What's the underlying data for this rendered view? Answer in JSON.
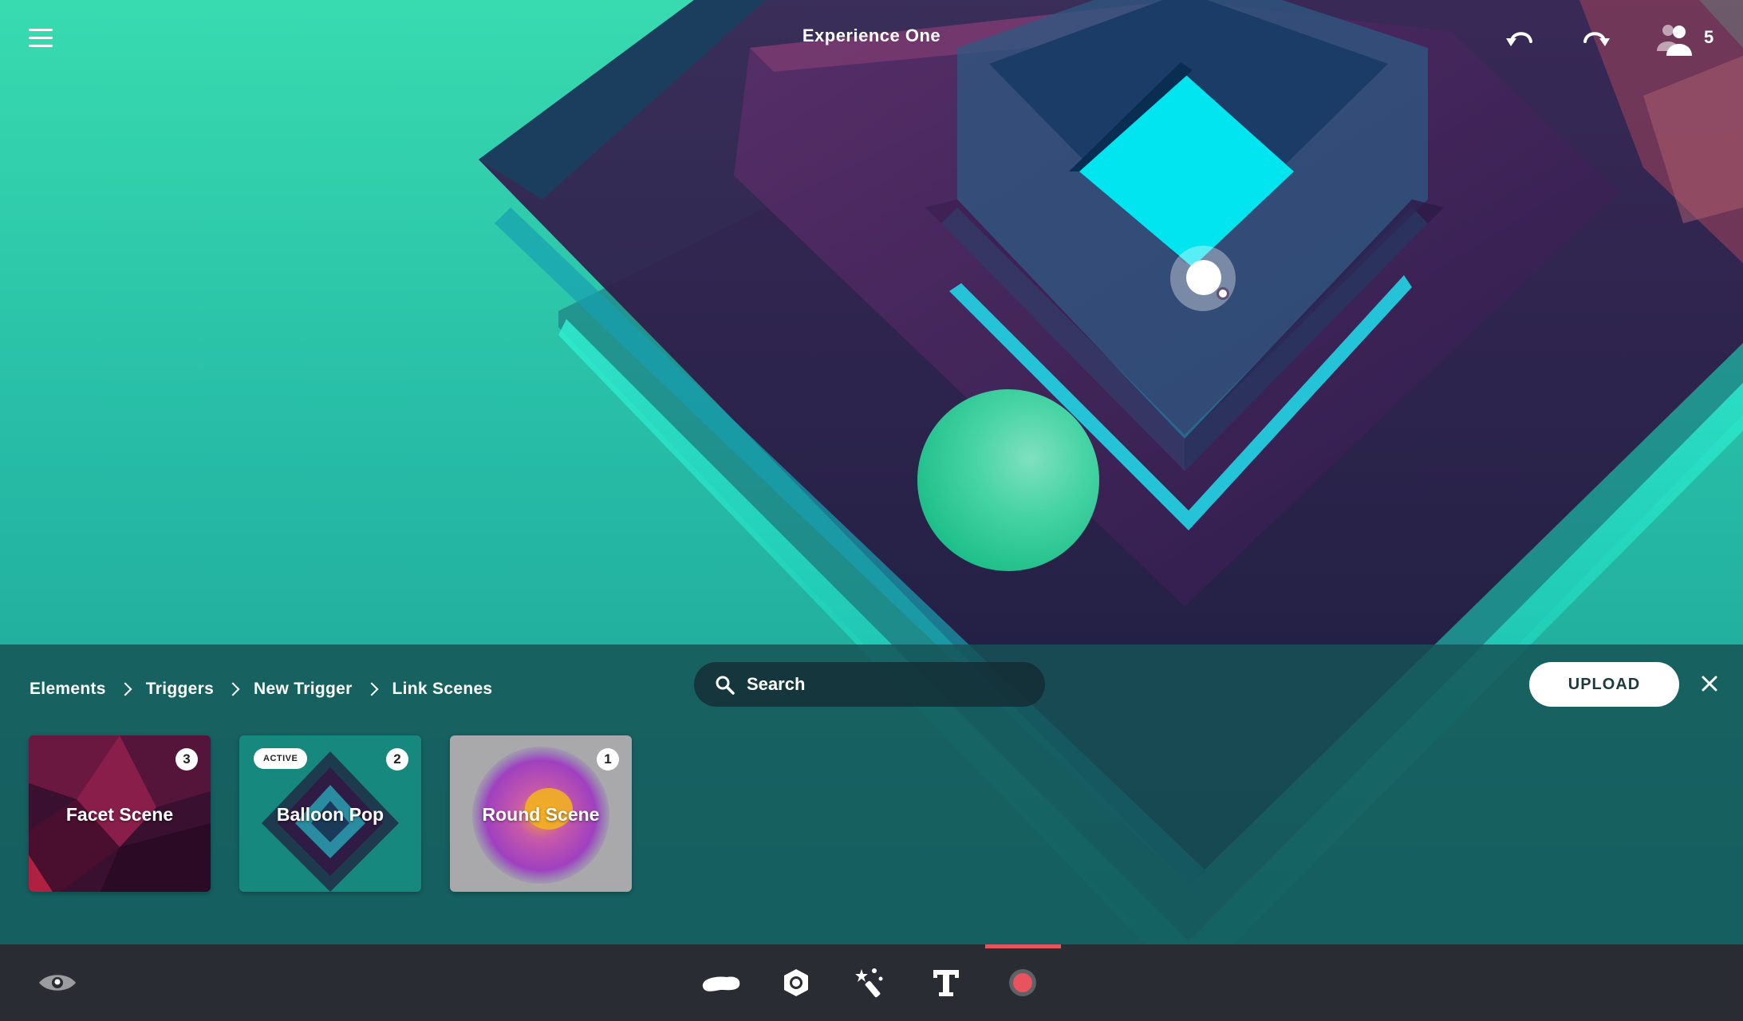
{
  "app": {
    "title": "Experience One",
    "user_count": "5"
  },
  "topbar": {
    "menu_icon": "hamburger-menu-icon",
    "undo_icon": "undo-icon",
    "redo_icon": "redo-icon",
    "users_icon": "users-icon"
  },
  "breadcrumb": [
    {
      "label": "Elements"
    },
    {
      "label": "Triggers"
    },
    {
      "label": "New Trigger"
    },
    {
      "label": "Link Scenes"
    }
  ],
  "search": {
    "placeholder": "Search",
    "value": ""
  },
  "upload_label": "UPLOAD",
  "scenes": [
    {
      "label": "Facet Scene",
      "count": "3",
      "badge": ""
    },
    {
      "label": "Balloon Pop",
      "count": "2",
      "badge": "ACTIVE"
    },
    {
      "label": "Round Scene",
      "count": "1",
      "badge": ""
    }
  ],
  "toolbar": {
    "tools": [
      "eye-icon",
      "object-icon",
      "hotspot-icon",
      "effects-icon",
      "text-icon",
      "record-icon"
    ],
    "active_tool": "record-icon"
  },
  "colors": {
    "accent": "#e8535d",
    "panel": "#165256",
    "toolbar": "#292d33",
    "cyan": "#00e5f0"
  }
}
